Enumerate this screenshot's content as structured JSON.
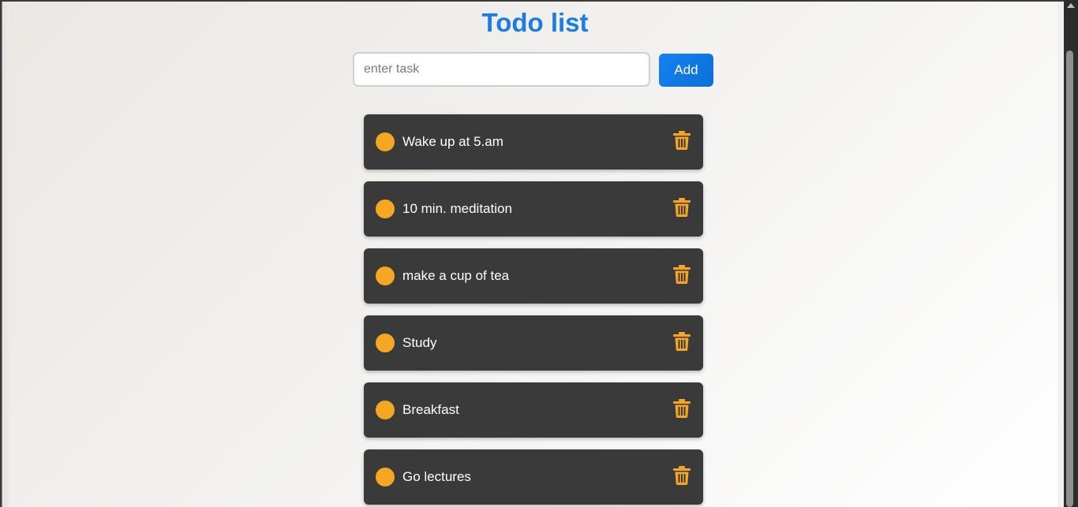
{
  "page": {
    "title": "Todo list"
  },
  "input": {
    "placeholder": "enter task",
    "value": ""
  },
  "add_button": {
    "label": "Add"
  },
  "colors": {
    "title": "#1a7de3",
    "accent": "#f5a623",
    "item_background": "#3a3a3a",
    "button": "#0b6fd8"
  },
  "todos": [
    {
      "text": "Wake up at 5.am",
      "check_icon": "circle-icon",
      "delete_icon": "trash-icon"
    },
    {
      "text": "10 min. meditation",
      "check_icon": "circle-icon",
      "delete_icon": "trash-icon"
    },
    {
      "text": "make a cup of tea",
      "check_icon": "circle-icon",
      "delete_icon": "trash-icon"
    },
    {
      "text": "Study",
      "check_icon": "circle-icon",
      "delete_icon": "trash-icon"
    },
    {
      "text": "Breakfast",
      "check_icon": "circle-icon",
      "delete_icon": "trash-icon"
    },
    {
      "text": "Go lectures",
      "check_icon": "circle-icon",
      "delete_icon": "trash-icon"
    }
  ]
}
